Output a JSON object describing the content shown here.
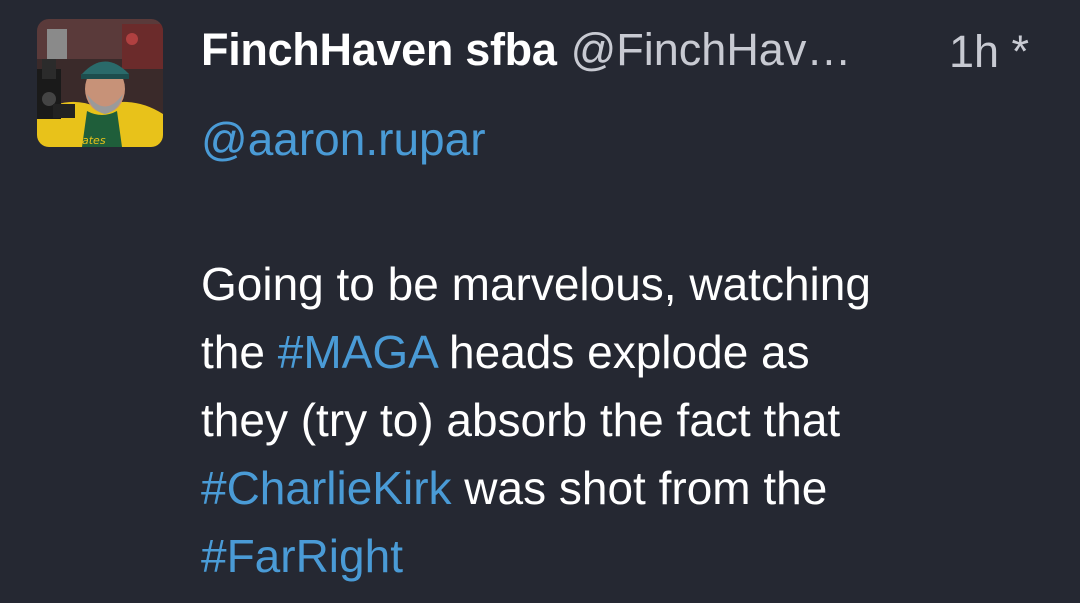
{
  "post": {
    "author": {
      "display_name": "FinchHaven sfba",
      "handle": "@FinchHav…",
      "avatar": "profile-photo-man-with-camera"
    },
    "timestamp": "1h *",
    "reply_mention": "@aaron.rupar",
    "body": {
      "line1": "Going to be marvelous, watching",
      "line2_prefix": "the ",
      "line2_hashtag": "#MAGA",
      "line2_suffix": " heads explode as",
      "line3": "they (try to) absorb the fact that",
      "line4_hashtag": "#CharlieKirk",
      "line4_suffix": " was shot from the",
      "line5_hashtag": "#FarRight"
    }
  },
  "colors": {
    "background": "#252832",
    "text": "#ffffff",
    "muted": "#c8cad2",
    "link": "#4a9bd6"
  }
}
